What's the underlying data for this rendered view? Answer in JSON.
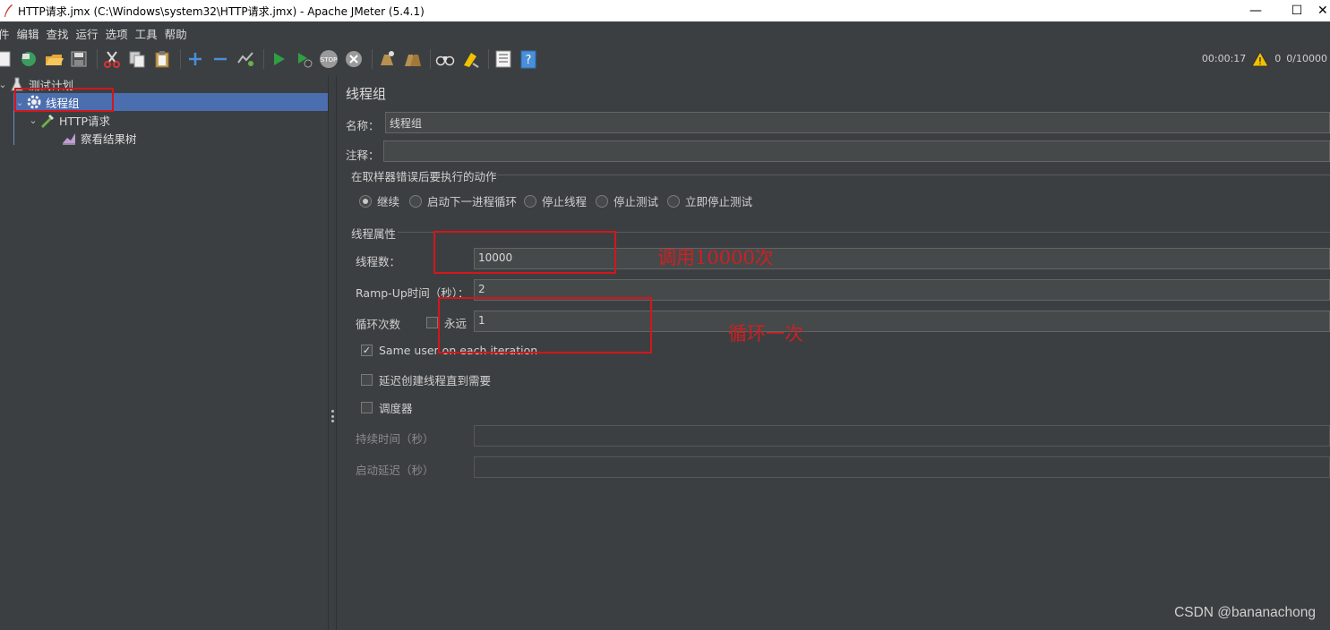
{
  "window": {
    "title": "HTTP请求.jmx (C:\\Windows\\system32\\HTTP请求.jmx) - Apache JMeter (5.4.1)",
    "minimize_glyph": "—",
    "maximize_glyph": "☐",
    "close_glyph": "✕"
  },
  "menu": [
    "文件",
    "编辑",
    "查找",
    "运行",
    "选项",
    "工具",
    "帮助"
  ],
  "menu_visible": [
    "文件",
    "编辑",
    "查找",
    "运行",
    "选项",
    "工具",
    "帮助"
  ],
  "toolbar": {
    "icons": [
      "new-icon",
      "templates-icon",
      "open-icon",
      "save-icon",
      "cut-icon",
      "copy-icon",
      "paste-icon",
      "expand-icon",
      "collapse-icon",
      "toggle-icon",
      "start-icon",
      "start-no-pause-icon",
      "stop-icon",
      "shutdown-icon",
      "clear-icon",
      "clear-all-icon",
      "search-icon",
      "reset-search-icon",
      "function-helper-icon",
      "help-icon"
    ],
    "elapsed_time": "00:00:17",
    "warning_count": "0",
    "threads_status": "0/10000"
  },
  "tree": {
    "test_plan": "测试计划",
    "thread_group": "线程组",
    "http_request": "HTTP请求",
    "result_tree": "察看结果树"
  },
  "panel": {
    "title": "线程组",
    "name_label": "名称：",
    "name_value": "线程组",
    "comment_label": "注释：",
    "comment_value": "",
    "error_action_label": "在取样器错误后要执行的动作",
    "error_actions": [
      "继续",
      "启动下一进程循环",
      "停止线程",
      "停止测试",
      "立即停止测试"
    ],
    "error_action_selected": "继续",
    "thread_props_label": "线程属性",
    "threads_label": "线程数：",
    "threads_value": "10000",
    "rampup_label": "Ramp-Up时间（秒）：",
    "rampup_value": "2",
    "loop_label": "循环次数",
    "forever_label": "永远",
    "forever_checked": false,
    "loop_value": "1",
    "same_user_label": "Same user on each iteration",
    "same_user_checked": true,
    "delay_create_label": "延迟创建线程直到需要",
    "delay_create_checked": false,
    "scheduler_label": "调度器",
    "scheduler_checked": false,
    "duration_label": "持续时间（秒）",
    "duration_value": "",
    "startup_delay_label": "启动延迟（秒）",
    "startup_delay_value": ""
  },
  "annotations": {
    "threads_note": "调用10000次",
    "loop_note": "循环一次"
  },
  "watermark": "CSDN @bananachong",
  "colors": {
    "background": "#3c3f41",
    "selection": "#4b6eaf",
    "annotation_red": "#d4161b"
  }
}
